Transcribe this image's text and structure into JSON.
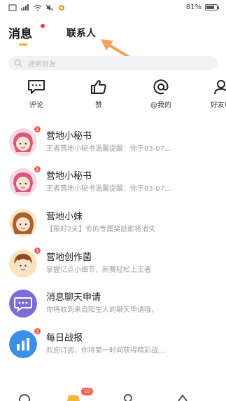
{
  "status_bar": {
    "battery_text": "81%",
    "battery_level": 0.81
  },
  "tabs": {
    "messages": "消息",
    "contacts": "联系人"
  },
  "search": {
    "placeholder": "搜索好友"
  },
  "quick_actions": [
    {
      "label": "评论",
      "icon": "comment-icon"
    },
    {
      "label": "赞",
      "icon": "thumbs-up-icon"
    },
    {
      "label": "@我的",
      "icon": "at-icon"
    },
    {
      "label": "好友申",
      "icon": "person-icon"
    }
  ],
  "messages": [
    {
      "title": "营地小秘书",
      "preview": "王者营地小秘书温馨提醒：你于03-07...",
      "badge": "1",
      "avatar": "girl-avatar",
      "accent": "#e88fb0"
    },
    {
      "title": "营地小秘书",
      "preview": "王者营地小秘书温馨提醒：你于03-07...",
      "badge": "1",
      "avatar": "girl-avatar",
      "accent": "#e88fb0"
    },
    {
      "title": "营地小妹",
      "preview": "【限时2天】你的专属奖励即将消失",
      "badge": "",
      "avatar": "girl-brown-avatar",
      "accent": "#f0b24a"
    },
    {
      "title": "营地创作菌",
      "preview": "掌握亿点小细节，新赛轻松上王者",
      "badge": "1",
      "avatar": "boy-avatar",
      "accent": "#f3a94c"
    },
    {
      "title": "消息聊天申请",
      "preview": "你将收到来自陌生人的聊天申请哦，",
      "badge": "",
      "avatar": "chat-bubble-avatar",
      "accent": "#7b6cd6"
    },
    {
      "title": "每日战报",
      "preview": "欢迎订阅，你将第一时间获得精彩战...",
      "badge": "1",
      "avatar": "bar-chart-avatar",
      "accent": "#3d8fe6"
    }
  ],
  "bottom_nav": {
    "badge": "10"
  }
}
